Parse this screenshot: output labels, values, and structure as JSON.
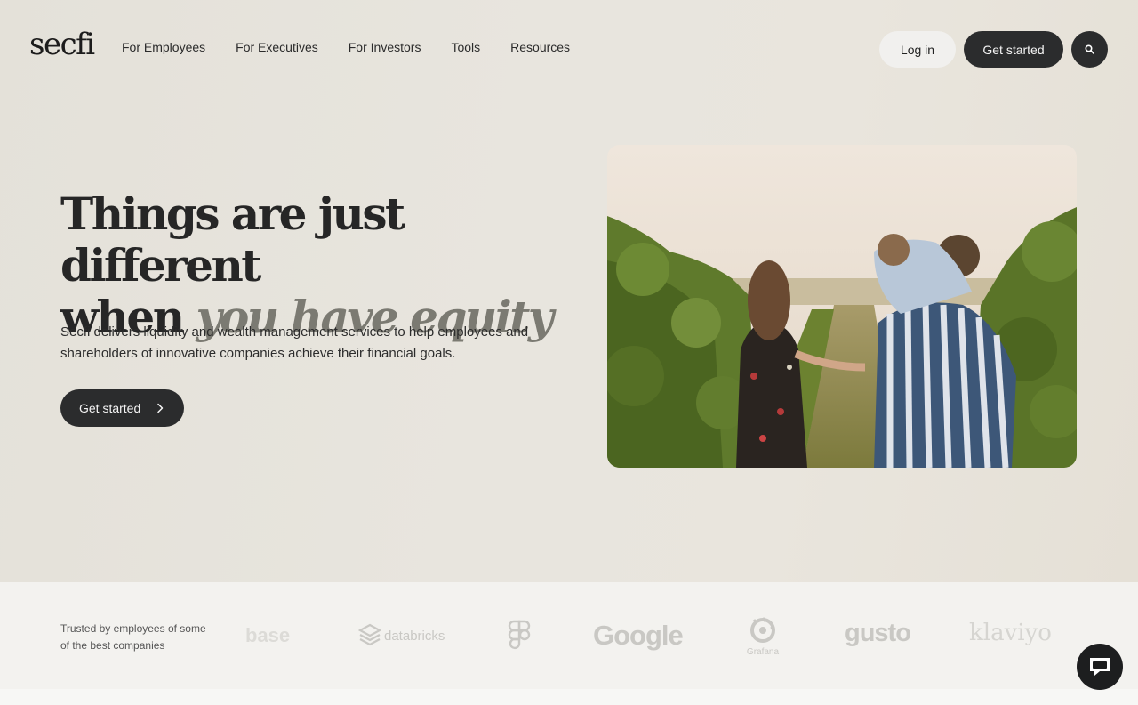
{
  "header": {
    "logo": "secfi",
    "nav": [
      {
        "label": "For Employees"
      },
      {
        "label": "For Executives"
      },
      {
        "label": "For Investors"
      },
      {
        "label": "Tools"
      },
      {
        "label": "Resources"
      }
    ],
    "login_label": "Log in",
    "get_started_label": "Get started",
    "search_icon": "search-icon"
  },
  "hero": {
    "headline_line1": "Things are just different",
    "headline_line2_plain": "when ",
    "headline_line2_accent": "you have equity",
    "subtext": "Secfi delivers liquidity and wealth management services to help employees and shareholders of innovative companies achieve their financial goals.",
    "cta_label": "Get started",
    "cta_icon": "chevron-right-icon"
  },
  "trusted": {
    "text": "Trusted by employees of some of the best companies",
    "logos": [
      {
        "name": "coinbase",
        "text": "base"
      },
      {
        "name": "databricks",
        "text": "databricks"
      },
      {
        "name": "figma",
        "text": ""
      },
      {
        "name": "google",
        "text": "Google"
      },
      {
        "name": "grafana",
        "text": "Grafana"
      },
      {
        "name": "gusto",
        "text": "gusto"
      },
      {
        "name": "klaviyo",
        "text": "klaviyo"
      }
    ]
  },
  "chat": {
    "icon": "chat-bubble-icon"
  },
  "colors": {
    "dark_button": "#2b2c2d",
    "light_button": "#f1f0ee",
    "accent_text": "#7b7a72",
    "hero_bg": "#e6e2da"
  }
}
